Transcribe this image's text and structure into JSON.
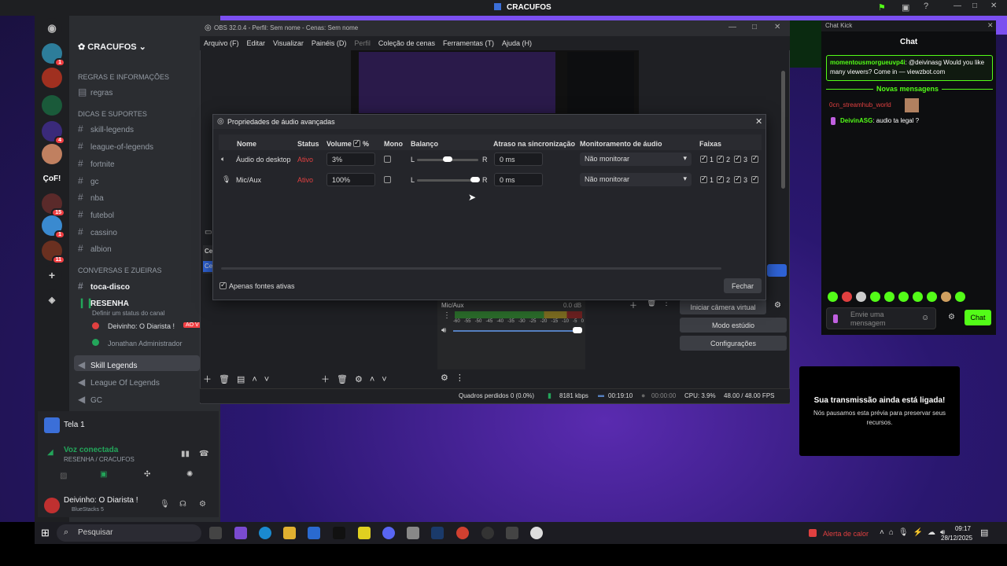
{
  "topbar": {
    "title": "CRACUFOS"
  },
  "discord": {
    "server_name": "CRACUFOS",
    "server_rail": [
      {
        "badge": "1"
      },
      {
        "badge": ""
      },
      {
        "badge": ""
      },
      {
        "badge": "4"
      },
      {
        "badge": ""
      },
      {
        "label": "ÇoF!"
      },
      {
        "badge": "15"
      },
      {
        "badge": "1"
      },
      {
        "badge": "11"
      }
    ],
    "sections": [
      {
        "label": "REGRAS E INFORMAÇÕES"
      },
      {
        "label": "DICAS E SUPORTES"
      },
      {
        "label": "CONVERSAS E ZUEIRAS"
      }
    ],
    "channels": [
      "regras",
      "skill-legends",
      "league-of-legends",
      "fortnite",
      "gc",
      "nba",
      "futebol",
      "cassino",
      "albion"
    ],
    "toca_disco": "toca-disco",
    "resenha": "RESENHA",
    "resenha_status": "Definir um status do canal",
    "voice_users": [
      {
        "name": "Deivinho: O Diarista !",
        "badge": "AO V"
      },
      {
        "name": "Jonathan Administrador"
      }
    ],
    "voice_channels": [
      "Skill Legends",
      "League Of Legends",
      "GC"
    ],
    "panel": {
      "tela": "Tela 1",
      "voice_connected": "Voz conectada",
      "voice_location": "RESENHA / CRACUFOS",
      "user": "Deivinho: O Diarista !",
      "user_status": "BlueStacks 5"
    }
  },
  "obs": {
    "title": "OBS 32.0.4 - Perfil: Sem nome - Cenas: Sem nome",
    "menu": [
      "Arquivo (F)",
      "Editar",
      "Visualizar",
      "Painéis (D)",
      "Perfil",
      "Coleção de cenas",
      "Ferramentas (T)",
      "Ajuda (H)"
    ],
    "mixer_source": "Mic/Aux",
    "mixer_db": "0.0 dB",
    "mixer_ticks": [
      "-60",
      "-55",
      "-50",
      "-45",
      "-40",
      "-35",
      "-30",
      "-25",
      "-20",
      "-15",
      "-10",
      "-5",
      "0"
    ],
    "controls": [
      "Iniciar câmera virtual",
      "Modo estúdio",
      "Configurações"
    ],
    "status": {
      "dropped": "Quadros perdidos 0 (0.0%)",
      "kbps": "8181 kbps",
      "rec_time": "00:19:10",
      "stream_time": "00:00:00",
      "cpu": "CPU: 3.9%",
      "fps": "48.00 / 48.00 FPS"
    },
    "scene_tab": "Ce"
  },
  "audio_dialog": {
    "title": "Propriedades de áudio avançadas",
    "headers": {
      "name": "Nome",
      "status": "Status",
      "volume": "Volume",
      "pct": "%",
      "mono": "Mono",
      "balance": "Balanço",
      "sync": "Atraso na sincronização",
      "monitor": "Monitoramento de áudio",
      "tracks": "Faixas"
    },
    "rows": [
      {
        "name": "Áudio do desktop",
        "status": "Ativo",
        "volume": "3%",
        "balance_l": "L",
        "balance_r": "R",
        "balance": 0.5,
        "sync": "0 ms",
        "monitor": "Não monitorar",
        "tracks": [
          "1",
          "2",
          "3"
        ]
      },
      {
        "name": "Mic/Aux",
        "status": "Ativo",
        "volume": "100%",
        "balance_l": "L",
        "balance_r": "R",
        "balance": 0.95,
        "sync": "0 ms",
        "monitor": "Não monitorar",
        "tracks": [
          "1",
          "2",
          "3"
        ]
      }
    ],
    "active_only": "Apenas fontes ativas",
    "close": "Fechar"
  },
  "chat": {
    "window_title": "Chat Kick",
    "heading": "Chat",
    "pinned_user": "momentousmorgueuvp4i",
    "pinned_text": ": @deivinasg Would you like many viewers? Come in — viewzbot.com",
    "new_messages": "Novas mensagens",
    "messages": [
      {
        "user": "0cn_streamhub_world",
        "text": ""
      },
      {
        "user": "DeivinASG",
        "text": ": audio ta legal ?"
      }
    ],
    "input_placeholder": "Envie uma mensagem",
    "send": "Chat"
  },
  "notice": {
    "title": "Sua transmissão ainda está ligada!",
    "body": "Nós pausamos esta prévia para preservar seus recursos."
  },
  "taskbar": {
    "search": "Pesquisar",
    "alert": "Alerta de calor",
    "time": "09:17",
    "date": "28/12/2025"
  },
  "colors": {
    "accent_green": "#53fc18",
    "status_red": "#e04040",
    "discord_blurple": "#5865f2"
  }
}
